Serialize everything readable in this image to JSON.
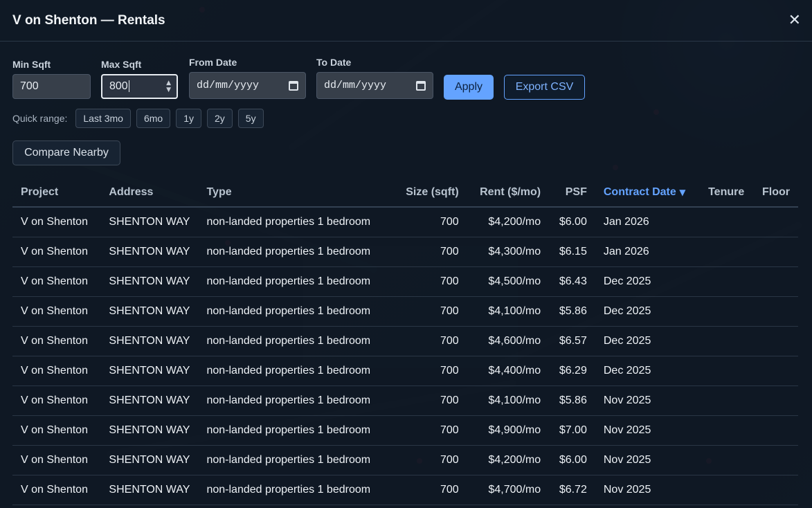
{
  "header": {
    "title": "V on Shenton — Rentals",
    "close_symbol": "✕"
  },
  "filters": {
    "min_sqft_label": "Min Sqft",
    "min_sqft_value": "700",
    "max_sqft_label": "Max Sqft",
    "max_sqft_value": "800",
    "from_date_label": "From Date",
    "from_date_placeholder": "dd/mm/yyyy",
    "to_date_label": "To Date",
    "to_date_placeholder": "dd/mm/yyyy",
    "apply_label": "Apply",
    "export_label": "Export CSV"
  },
  "quick_range": {
    "label": "Quick range:",
    "options": [
      "Last 3mo",
      "6mo",
      "1y",
      "2y",
      "5y"
    ]
  },
  "compare_label": "Compare Nearby",
  "colors": {
    "accent": "#64a3ff",
    "background": "#0f1a26"
  },
  "table": {
    "columns": [
      "Project",
      "Address",
      "Type",
      "Size (sqft)",
      "Rent ($/mo)",
      "PSF",
      "Contract Date",
      "Tenure",
      "Floor"
    ],
    "sorted_column": "Contract Date",
    "sort_direction_symbol": "▼",
    "rows": [
      [
        "V on Shenton",
        "SHENTON WAY",
        "non-landed properties 1 bedroom",
        "700",
        "$4,200/mo",
        "$6.00",
        "Jan 2026",
        "",
        ""
      ],
      [
        "V on Shenton",
        "SHENTON WAY",
        "non-landed properties 1 bedroom",
        "700",
        "$4,300/mo",
        "$6.15",
        "Jan 2026",
        "",
        ""
      ],
      [
        "V on Shenton",
        "SHENTON WAY",
        "non-landed properties 1 bedroom",
        "700",
        "$4,500/mo",
        "$6.43",
        "Dec 2025",
        "",
        ""
      ],
      [
        "V on Shenton",
        "SHENTON WAY",
        "non-landed properties 1 bedroom",
        "700",
        "$4,100/mo",
        "$5.86",
        "Dec 2025",
        "",
        ""
      ],
      [
        "V on Shenton",
        "SHENTON WAY",
        "non-landed properties 1 bedroom",
        "700",
        "$4,600/mo",
        "$6.57",
        "Dec 2025",
        "",
        ""
      ],
      [
        "V on Shenton",
        "SHENTON WAY",
        "non-landed properties 1 bedroom",
        "700",
        "$4,400/mo",
        "$6.29",
        "Dec 2025",
        "",
        ""
      ],
      [
        "V on Shenton",
        "SHENTON WAY",
        "non-landed properties 1 bedroom",
        "700",
        "$4,100/mo",
        "$5.86",
        "Nov 2025",
        "",
        ""
      ],
      [
        "V on Shenton",
        "SHENTON WAY",
        "non-landed properties 1 bedroom",
        "700",
        "$4,900/mo",
        "$7.00",
        "Nov 2025",
        "",
        ""
      ],
      [
        "V on Shenton",
        "SHENTON WAY",
        "non-landed properties 1 bedroom",
        "700",
        "$4,200/mo",
        "$6.00",
        "Nov 2025",
        "",
        ""
      ],
      [
        "V on Shenton",
        "SHENTON WAY",
        "non-landed properties 1 bedroom",
        "700",
        "$4,700/mo",
        "$6.72",
        "Nov 2025",
        "",
        ""
      ]
    ]
  }
}
